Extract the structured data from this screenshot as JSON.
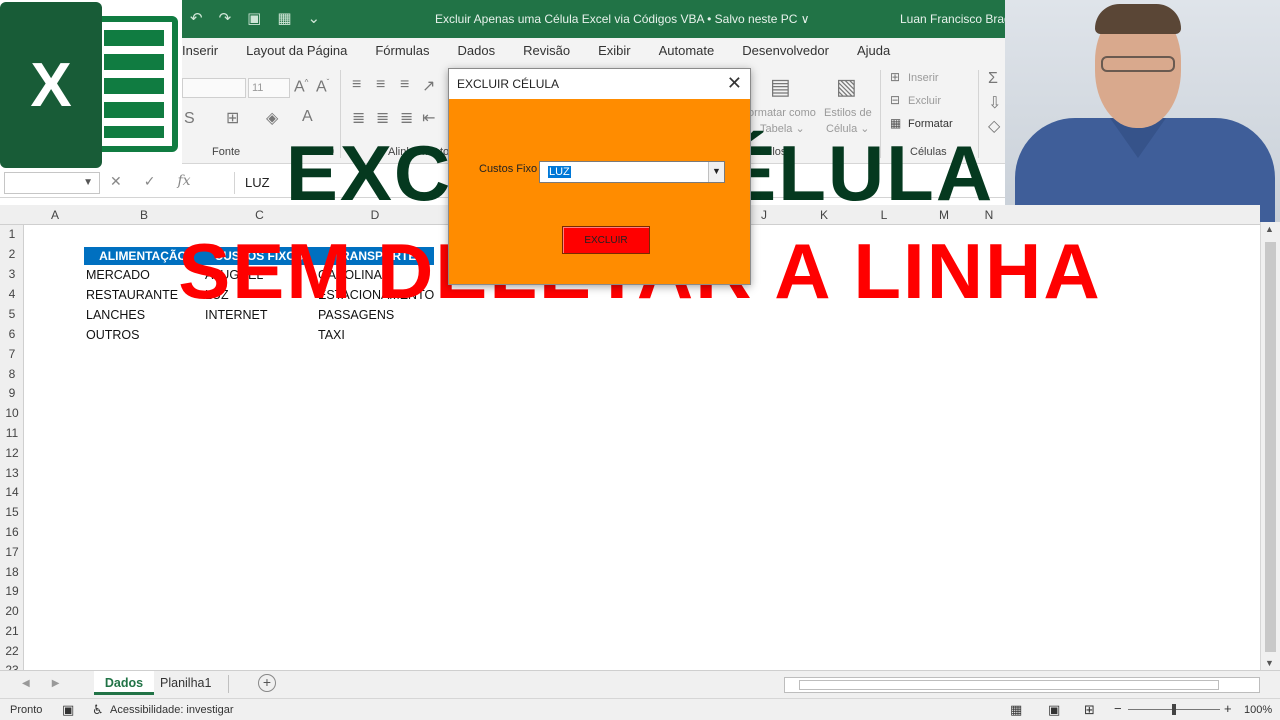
{
  "window": {
    "title": "Excluir Apenas uma Célula Excel via Códigos VBA  •  Salvo neste PC ∨",
    "user": "Luan Francisco Brag"
  },
  "logo": {
    "letter": "X"
  },
  "ribbon": {
    "tabs": [
      "Inserir",
      "Layout da Página",
      "Fórmulas",
      "Dados",
      "Revisão",
      "Exibir",
      "Automate",
      "Desenvolvedor",
      "Ajuda"
    ],
    "groups": {
      "fonte": "Fonte",
      "alinhamento": "Alinhamento",
      "estilos": "Estilos",
      "celulas": "Células"
    },
    "font_size": "11",
    "formatar_como_tabela_1": "ormatar como",
    "formatar_como_tabela_2": "Tabela ⌄",
    "estilos_celula_1": "Estilos de",
    "estilos_celula_2": "Célula ⌄",
    "inserir": "Inserir",
    "excluir": "Excluir",
    "formatar": "Formatar"
  },
  "formula_bar": {
    "name_box": "",
    "formula": "LUZ"
  },
  "columns": [
    "A",
    "B",
    "C",
    "D",
    "J",
    "K",
    "L",
    "M",
    "N"
  ],
  "rows": [
    "1",
    "2",
    "3",
    "4",
    "5",
    "6",
    "7",
    "8",
    "9",
    "10",
    "11",
    "12",
    "13",
    "14",
    "15",
    "16",
    "17",
    "18",
    "19",
    "20",
    "21",
    "22",
    "23"
  ],
  "table": {
    "headers": [
      "ALIMENTAÇÃO",
      "CUSTOS FIXOS",
      "TRANSPORTE"
    ],
    "col_b": [
      "MERCADO",
      "RESTAURANTE",
      "LANCHES",
      "OUTROS"
    ],
    "col_c": [
      "ALUGUEL",
      "LUZ",
      "INTERNET"
    ],
    "col_d": [
      "GASOLINA",
      "ESTACIONAMENTO",
      "PASSAGENS",
      "TAXI"
    ]
  },
  "overlay": {
    "line1": "EXCLUIR CÉLULA",
    "line2": "SEM DELETAR A LINHA"
  },
  "dialog": {
    "title": "EXCLUIR CÉLULA",
    "close": "✕",
    "label": "Custos Fixo",
    "combo_value": "LUZ",
    "button": "EXCLUIR"
  },
  "sheets": {
    "active": "Dados",
    "other": "Planilha1"
  },
  "status": {
    "ready": "Pronto",
    "accessibility": "Acessibilidade: investigar",
    "zoom": "100%"
  },
  "colors": {
    "excel_green": "#217346",
    "header_blue": "#0070c0",
    "dialog_orange": "#ff8c00",
    "button_red": "#ff0000",
    "overlay_green": "#05391f",
    "overlay_red": "#ff0000"
  }
}
